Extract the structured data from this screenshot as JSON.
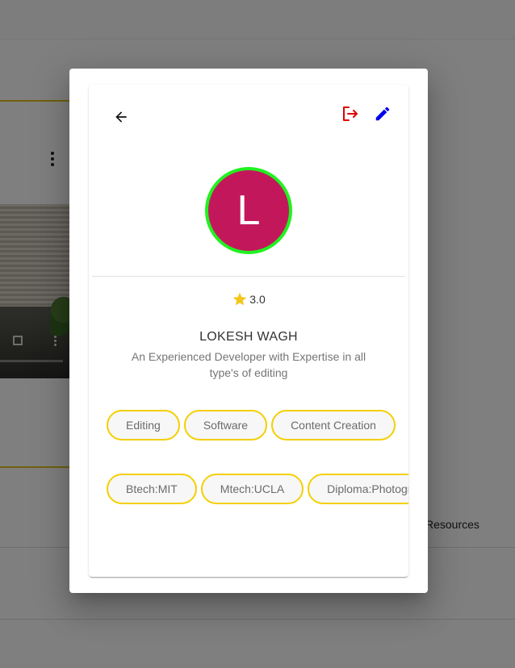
{
  "background": {
    "resources_label": "Resources"
  },
  "profile": {
    "avatar_letter": "L",
    "avatar_color": "#c2185b",
    "avatar_ring_color": "#21f121",
    "rating": "3.0",
    "name": "LOKESH WAGH",
    "bio": "An Experienced Developer with Expertise in all type's of editing",
    "skills": [
      "Editing",
      "Software",
      "Content Creation"
    ],
    "education": [
      "Btech:MIT",
      "Mtech:UCLA",
      "Diploma:Photography"
    ]
  },
  "icons": {
    "back": "arrow-back-icon",
    "logout": "logout-icon",
    "edit": "pencil-icon",
    "rating": "star-icon"
  },
  "colors": {
    "logout_icon": "#e00000",
    "edit_icon": "#0000ee",
    "star": "#f5c518",
    "chip_border": "#f5cf00"
  }
}
